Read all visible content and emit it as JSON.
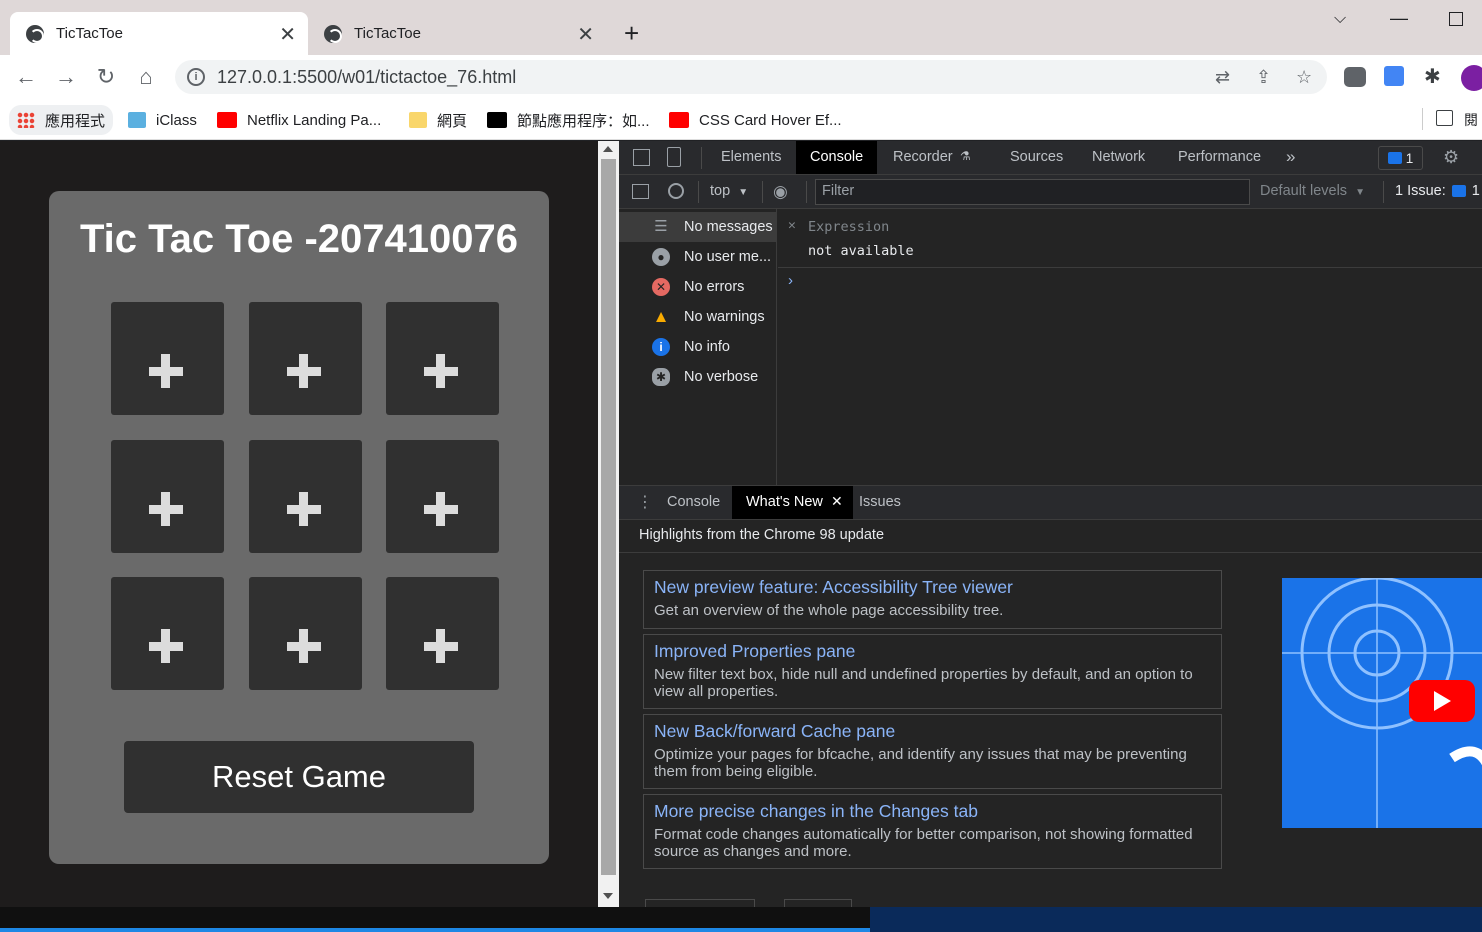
{
  "browser": {
    "tabs": [
      {
        "title": "TicTacToe",
        "active": true
      },
      {
        "title": "TicTacToe",
        "active": false
      }
    ],
    "url": "127.0.0.1:5500/w01/tictactoe_76.html",
    "bookmarks": [
      {
        "label": "應用程式",
        "icon": "apps-icon"
      },
      {
        "label": "iClass",
        "icon": "iclass-icon"
      },
      {
        "label": "Netflix Landing Pa...",
        "icon": "youtube-icon"
      },
      {
        "label": "網頁",
        "icon": "folder-icon"
      },
      {
        "label": "節點應用程序：如...",
        "icon": "dev-icon"
      },
      {
        "label": "CSS Card Hover Ef...",
        "icon": "youtube-icon"
      },
      {
        "label": "閱"
      }
    ]
  },
  "game": {
    "title": "Tic Tac Toe -207410076",
    "reset_label": "Reset Game"
  },
  "devtools": {
    "tabs": [
      "Elements",
      "Console",
      "Recorder",
      "Sources",
      "Network",
      "Performance"
    ],
    "active_tab": "Console",
    "message_badge": "1",
    "context": "top",
    "filter_placeholder": "Filter",
    "levels": "Default levels",
    "issues": "1 Issue:",
    "issues_count": "1",
    "sidebar": [
      {
        "label": "No messages",
        "icon": "list-icon"
      },
      {
        "label": "No user me...",
        "icon": "user-icon"
      },
      {
        "label": "No errors",
        "icon": "error-icon"
      },
      {
        "label": "No warnings",
        "icon": "warning-icon"
      },
      {
        "label": "No info",
        "icon": "info-icon"
      },
      {
        "label": "No verbose",
        "icon": "bug-icon"
      }
    ],
    "expression_label": "Expression",
    "expression_value": "not available",
    "drawer_tabs": [
      "Console",
      "What's New",
      "Issues"
    ],
    "highlights": "Highlights from the Chrome 98 update",
    "whats_new": [
      {
        "title": "New preview feature: Accessibility Tree viewer",
        "desc": "Get an overview of the whole page accessibility tree."
      },
      {
        "title": "Improved Properties pane",
        "desc": "New filter text box, hide null and undefined properties by default, and an option to view all properties."
      },
      {
        "title": "New Back/forward Cache pane",
        "desc": "Optimize your pages for bfcache, and identify any issues that may be preventing them from being eligible."
      },
      {
        "title": "More precise changes in the Changes tab",
        "desc": "Format code changes automatically for better comparison, not showing formatted source as changes and more."
      }
    ]
  }
}
